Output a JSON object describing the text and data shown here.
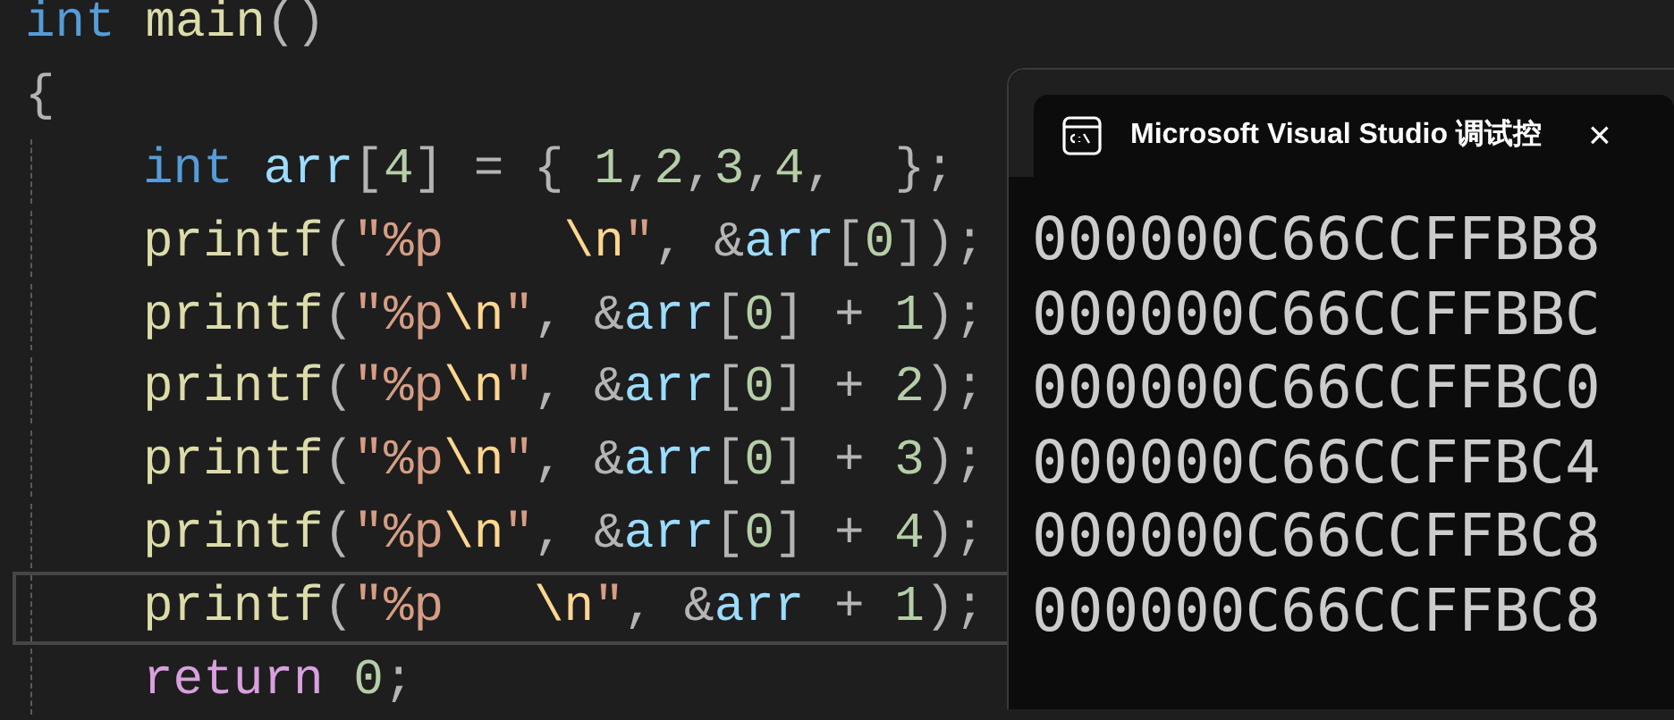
{
  "editor": {
    "lines": [
      {
        "current": false,
        "indent": false,
        "tokens": [
          {
            "text": "int",
            "kind": "keyword"
          },
          {
            "text": " main",
            "kind": "function"
          },
          {
            "text": "()",
            "kind": "punct"
          }
        ]
      },
      {
        "current": false,
        "indent": false,
        "tokens": [
          {
            "text": "{",
            "kind": "punct"
          }
        ]
      },
      {
        "current": false,
        "indent": true,
        "tokens": [
          {
            "text": "int",
            "kind": "keyword"
          },
          {
            "text": " arr",
            "kind": "variable"
          },
          {
            "text": "[",
            "kind": "punct"
          },
          {
            "text": "4",
            "kind": "number"
          },
          {
            "text": "] = { ",
            "kind": "punct"
          },
          {
            "text": "1",
            "kind": "number"
          },
          {
            "text": ",",
            "kind": "punct"
          },
          {
            "text": "2",
            "kind": "number"
          },
          {
            "text": ",",
            "kind": "punct"
          },
          {
            "text": "3",
            "kind": "number"
          },
          {
            "text": ",",
            "kind": "punct"
          },
          {
            "text": "4",
            "kind": "number"
          },
          {
            "text": ",  };",
            "kind": "punct"
          }
        ]
      },
      {
        "current": false,
        "indent": true,
        "tokens": [
          {
            "text": "printf",
            "kind": "function"
          },
          {
            "text": "(",
            "kind": "punct"
          },
          {
            "text": "\"%p    ",
            "kind": "string"
          },
          {
            "text": "\\n",
            "kind": "escape"
          },
          {
            "text": "\"",
            "kind": "string"
          },
          {
            "text": ", &",
            "kind": "punct"
          },
          {
            "text": "arr",
            "kind": "variable"
          },
          {
            "text": "[",
            "kind": "punct"
          },
          {
            "text": "0",
            "kind": "number"
          },
          {
            "text": "]);",
            "kind": "punct"
          }
        ]
      },
      {
        "current": false,
        "indent": true,
        "tokens": [
          {
            "text": "printf",
            "kind": "function"
          },
          {
            "text": "(",
            "kind": "punct"
          },
          {
            "text": "\"%p",
            "kind": "string"
          },
          {
            "text": "\\n",
            "kind": "escape"
          },
          {
            "text": "\"",
            "kind": "string"
          },
          {
            "text": ", &",
            "kind": "punct"
          },
          {
            "text": "arr",
            "kind": "variable"
          },
          {
            "text": "[",
            "kind": "punct"
          },
          {
            "text": "0",
            "kind": "number"
          },
          {
            "text": "] + ",
            "kind": "punct"
          },
          {
            "text": "1",
            "kind": "number"
          },
          {
            "text": ");",
            "kind": "punct"
          }
        ]
      },
      {
        "current": false,
        "indent": true,
        "tokens": [
          {
            "text": "printf",
            "kind": "function"
          },
          {
            "text": "(",
            "kind": "punct"
          },
          {
            "text": "\"%p",
            "kind": "string"
          },
          {
            "text": "\\n",
            "kind": "escape"
          },
          {
            "text": "\"",
            "kind": "string"
          },
          {
            "text": ", &",
            "kind": "punct"
          },
          {
            "text": "arr",
            "kind": "variable"
          },
          {
            "text": "[",
            "kind": "punct"
          },
          {
            "text": "0",
            "kind": "number"
          },
          {
            "text": "] + ",
            "kind": "punct"
          },
          {
            "text": "2",
            "kind": "number"
          },
          {
            "text": ");",
            "kind": "punct"
          }
        ]
      },
      {
        "current": false,
        "indent": true,
        "tokens": [
          {
            "text": "printf",
            "kind": "function"
          },
          {
            "text": "(",
            "kind": "punct"
          },
          {
            "text": "\"%p",
            "kind": "string"
          },
          {
            "text": "\\n",
            "kind": "escape"
          },
          {
            "text": "\"",
            "kind": "string"
          },
          {
            "text": ", &",
            "kind": "punct"
          },
          {
            "text": "arr",
            "kind": "variable"
          },
          {
            "text": "[",
            "kind": "punct"
          },
          {
            "text": "0",
            "kind": "number"
          },
          {
            "text": "] + ",
            "kind": "punct"
          },
          {
            "text": "3",
            "kind": "number"
          },
          {
            "text": ");",
            "kind": "punct"
          }
        ]
      },
      {
        "current": false,
        "indent": true,
        "tokens": [
          {
            "text": "printf",
            "kind": "function"
          },
          {
            "text": "(",
            "kind": "punct"
          },
          {
            "text": "\"%p",
            "kind": "string"
          },
          {
            "text": "\\n",
            "kind": "escape"
          },
          {
            "text": "\"",
            "kind": "string"
          },
          {
            "text": ", &",
            "kind": "punct"
          },
          {
            "text": "arr",
            "kind": "variable"
          },
          {
            "text": "[",
            "kind": "punct"
          },
          {
            "text": "0",
            "kind": "number"
          },
          {
            "text": "] + ",
            "kind": "punct"
          },
          {
            "text": "4",
            "kind": "number"
          },
          {
            "text": ");",
            "kind": "punct"
          }
        ]
      },
      {
        "current": true,
        "indent": true,
        "tokens": [
          {
            "text": "printf",
            "kind": "function"
          },
          {
            "text": "(",
            "kind": "punct"
          },
          {
            "text": "\"%p   ",
            "kind": "string"
          },
          {
            "text": "\\n",
            "kind": "escape"
          },
          {
            "text": "\"",
            "kind": "string"
          },
          {
            "text": ", &",
            "kind": "punct"
          },
          {
            "text": "arr",
            "kind": "variable"
          },
          {
            "text": " + ",
            "kind": "punct"
          },
          {
            "text": "1",
            "kind": "number"
          },
          {
            "text": ");",
            "kind": "punct"
          }
        ]
      },
      {
        "current": false,
        "indent": true,
        "tokens": [
          {
            "text": "return",
            "kind": "control"
          },
          {
            "text": " 0",
            "kind": "number"
          },
          {
            "text": ";",
            "kind": "punct"
          }
        ]
      }
    ]
  },
  "console": {
    "title": "Microsoft Visual Studio 调试控",
    "close": "×",
    "output": [
      "000000C66CCFFBB8",
      "000000C66CCFFBBC",
      "000000C66CCFFBC0",
      "000000C66CCFFBC4",
      "000000C66CCFFBC8",
      "000000C66CCFFBC8"
    ]
  }
}
